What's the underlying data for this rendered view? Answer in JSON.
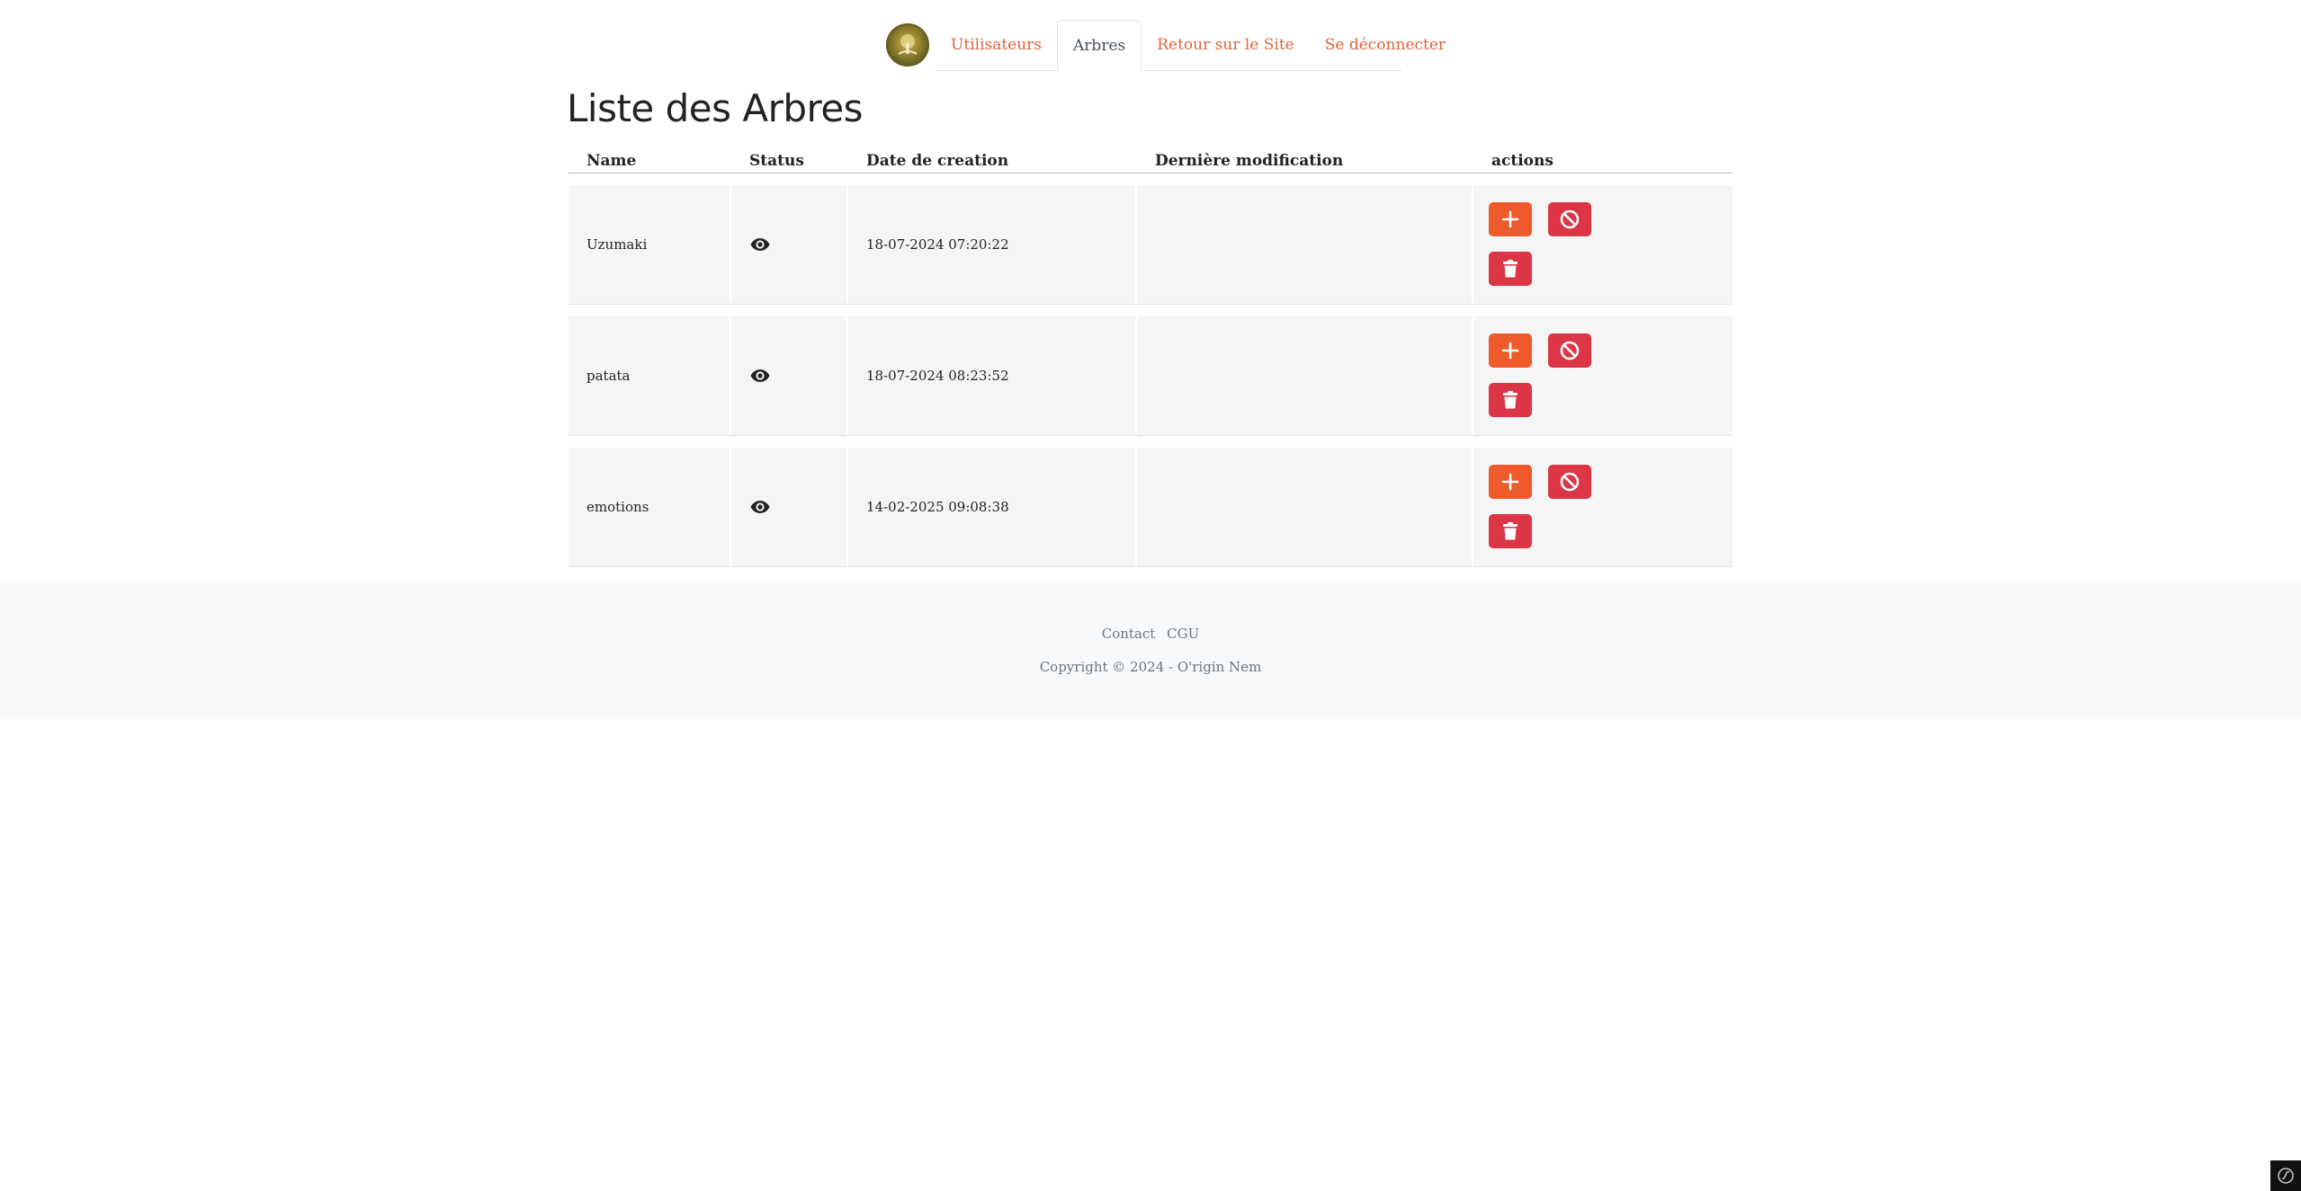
{
  "nav": {
    "tabs": [
      {
        "label": "Utilisateurs"
      },
      {
        "label": "Arbres"
      },
      {
        "label": "Retour sur le Site"
      },
      {
        "label": "Se déconnecter"
      }
    ],
    "active_tab": "Arbres",
    "accent_color": "#e0633a"
  },
  "page": {
    "title": "Liste des Arbres"
  },
  "table": {
    "headers": [
      "Name",
      "Status",
      "Date de creation",
      "Dernière modification",
      "actions"
    ],
    "rows": [
      {
        "name": "Uzumaki",
        "status_icon": "eye-icon",
        "created": "18-07-2024 07:20:22",
        "modified": ""
      },
      {
        "name": "patata",
        "status_icon": "eye-icon",
        "created": "18-07-2024 08:23:52",
        "modified": ""
      },
      {
        "name": "emotions",
        "status_icon": "eye-icon",
        "created": "14-02-2025 09:08:38",
        "modified": ""
      }
    ],
    "action_icons": [
      "plus-icon",
      "ban-icon",
      "trash-icon"
    ],
    "colors": {
      "add": "#ee5a2b",
      "danger": "#dc3545"
    }
  },
  "footer": {
    "links": [
      "Contact",
      "CGU"
    ],
    "copyright": "Copyright © 2024 - O'rigin Nem"
  }
}
